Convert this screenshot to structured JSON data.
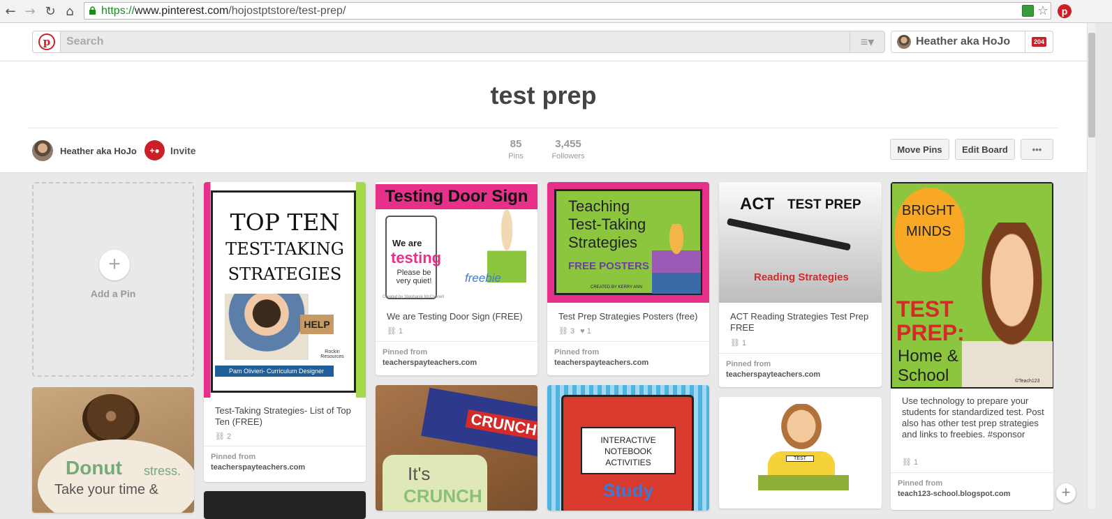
{
  "browser": {
    "url_scheme": "https://",
    "url_host": "www.pinterest.com",
    "url_path": "/hojostptstore/test-prep/"
  },
  "header": {
    "search_placeholder": "Search",
    "user_name": "Heather aka HoJo",
    "notification_count": "204"
  },
  "board": {
    "title": "test prep",
    "owner": "Heather aka HoJo",
    "invite_label": "Invite",
    "pins_count": "85",
    "pins_label": "Pins",
    "followers_count": "3,455",
    "followers_label": "Followers",
    "move_pins_label": "Move Pins",
    "edit_board_label": "Edit Board",
    "more_label": "•••"
  },
  "add_pin": {
    "label": "Add a Pin"
  },
  "pins": {
    "p1": {
      "img_text": [
        "TOP TEN",
        "TEST-TAKING",
        "STRATEGIES",
        "HELP",
        "Pam Olivieri- Curriculum Designer",
        "Rockin Resources"
      ],
      "desc": "Test-Taking Strategies- List of Top Ten (FREE)",
      "repins": "2",
      "pinned_from": "Pinned from",
      "source": "teacherspayteachers.com"
    },
    "p2": {
      "img_text": [
        "Testing Door Sign",
        "We are",
        "testing",
        "Please be very quiet!",
        "freebie",
        "Created by Stephanie McConnell"
      ],
      "desc": "We are Testing Door Sign (FREE)",
      "repins": "1",
      "pinned_from": "Pinned from",
      "source": "teacherspayteachers.com"
    },
    "p3": {
      "img_text": [
        "Teaching",
        "Test-Taking",
        "Strategies",
        "FREE POSTERS",
        "CREATED BY KERRY ANN"
      ],
      "desc": "Test Prep Strategies Posters (free)",
      "repins": "3",
      "likes": "1",
      "pinned_from": "Pinned from",
      "source": "teacherspayteachers.com"
    },
    "p4": {
      "img_text": [
        "ACT",
        "TEST PREP",
        "Reading Strategies"
      ],
      "desc": "ACT Reading Strategies Test Prep FREE",
      "repins": "1",
      "pinned_from": "Pinned from",
      "source": "teacherspayteachers.com"
    },
    "p5": {
      "img_text": [
        "BRIGHT",
        "MINDS",
        "TEST",
        "PREP:",
        "Home &",
        "School",
        "©Teach123"
      ],
      "desc": "Use technology to prepare your students for standardized test. Post also has other test prep strategies and links to freebies. #sponsor",
      "repins": "1",
      "pinned_from": "Pinned from",
      "source": "teach123-school.blogspot.com"
    },
    "p6": {
      "img_text": [
        "Donut",
        "stress.",
        "Take your time &"
      ]
    },
    "p7": {
      "img_text": [
        "CRUNCH",
        "It's",
        "CRUNCH"
      ]
    },
    "p8": {
      "img_text": [
        "INTERACTIVE",
        "NOTEBOOK",
        "ACTIVITIES",
        "Study"
      ]
    },
    "p9": {
      "img_text": [
        "TEST"
      ]
    }
  },
  "colors": {
    "pinterest_red": "#cb2027",
    "background": "#e9e9e9"
  }
}
